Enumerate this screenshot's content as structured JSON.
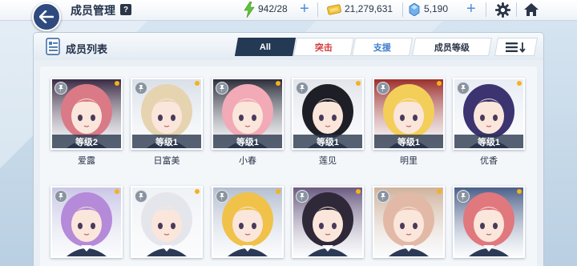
{
  "header": {
    "title": "成员管理",
    "help_label": "?",
    "ap": "942/28",
    "credits": "21,279,631",
    "gems": "5,190",
    "plus": "+"
  },
  "panel": {
    "title": "成员列表",
    "tabs": [
      {
        "label": "All"
      },
      {
        "label": "突击"
      },
      {
        "label": "支援"
      }
    ],
    "sort_label": "成员等级"
  },
  "students": [
    {
      "name": "爱露",
      "level": "等级2",
      "hair": "#d97a86",
      "bg": "#3a2a44"
    },
    {
      "name": "日富美",
      "level": "等级1",
      "hair": "#e6d3b0",
      "bg": "#d9dfe8"
    },
    {
      "name": "小春",
      "level": "等级1",
      "hair": "#f2aab7",
      "bg": "#2b2d3a"
    },
    {
      "name": "莲见",
      "level": "等级1",
      "hair": "#1e1e26",
      "bg": "#e2e4ea"
    },
    {
      "name": "明里",
      "level": "等级1",
      "hair": "#f3cf5a",
      "bg": "#9b2f2c"
    },
    {
      "name": "优香",
      "level": "等级1",
      "hair": "#3b3470",
      "bg": "#e8ecf3"
    },
    {
      "name": "",
      "level": "",
      "hair": "#b58ad8",
      "bg": "#c9c6e6"
    },
    {
      "name": "",
      "level": "",
      "hair": "#e4e6ec",
      "bg": "#eef1f5"
    },
    {
      "name": "",
      "level": "",
      "hair": "#f0c24a",
      "bg": "#b3bed0"
    },
    {
      "name": "",
      "level": "",
      "hair": "#2f2838",
      "bg": "#6a5a80"
    },
    {
      "name": "",
      "level": "",
      "hair": "#e2b9a6",
      "bg": "#cfb29c"
    },
    {
      "name": "",
      "level": "",
      "hair": "#e0787e",
      "bg": "#4a5f88"
    }
  ]
}
